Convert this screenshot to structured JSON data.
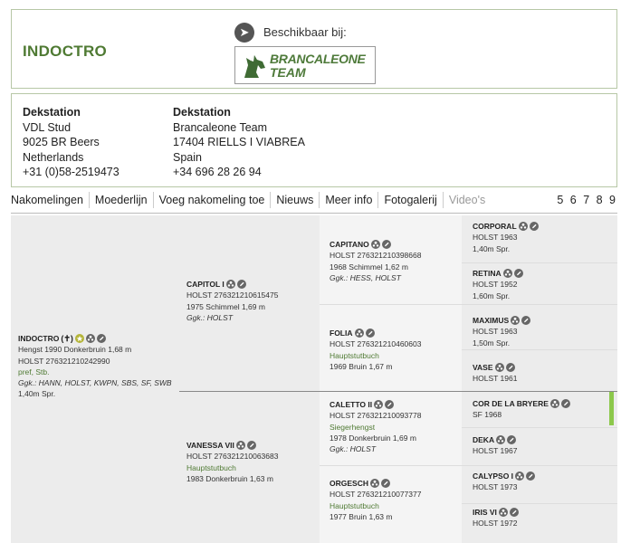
{
  "header": {
    "title": "INDOCTRO",
    "available_label": "Beschikbaar bij:",
    "logo_line1": "BRANCALEONE",
    "logo_line2": "TEAM"
  },
  "stations": [
    {
      "heading": "Dekstation",
      "lines": [
        "VDL Stud",
        "9025 BR Beers",
        "Netherlands",
        "+31 (0)58-2519473"
      ]
    },
    {
      "heading": "Dekstation",
      "lines": [
        "Brancaleone Team",
        "17404 RIELLS I VIABREA",
        "Spain",
        "+34 696 28 26 94"
      ]
    }
  ],
  "nav": {
    "tabs": [
      "Nakomelingen",
      "Moederlijn",
      "Voeg nakomeling toe",
      "Nieuws",
      "Meer info",
      "Fotogalerij",
      "Video's"
    ],
    "pages": "5 6 7 8 9"
  },
  "pedigree": {
    "main": {
      "name": "INDOCTRO",
      "cross": "(✝)",
      "l1": "Hengst 1990 Donkerbruin 1,68 m",
      "l2": "HOLST 276321210242990",
      "l3": "pref, Stb.",
      "l4": "Ggk.: HANN, HOLST, KWPN, SBS, SF, SWB",
      "l5": "1,40m Spr."
    },
    "capitol": {
      "name": "CAPITOL I",
      "l1": "HOLST 276321210615475",
      "l2": "1975 Schimmel 1,69 m",
      "l3": "Ggk.: HOLST"
    },
    "vanessa": {
      "name": "VANESSA VII",
      "l1": "HOLST 276321210063683",
      "l2": "Hauptstutbuch",
      "l3": "1983 Donkerbruin 1,63 m"
    },
    "capitano": {
      "name": "CAPITANO",
      "l1": "HOLST 276321210398668",
      "l2": "1968 Schimmel 1,62 m",
      "l3": "Ggk.: HESS, HOLST"
    },
    "folia": {
      "name": "FOLIA",
      "l1": "HOLST 276321210460603",
      "l2": "Hauptstutbuch",
      "l3": "1969 Bruin 1,67 m"
    },
    "caletto": {
      "name": "CALETTO II",
      "l1": "HOLST 276321210093778",
      "l2": "Siegerhengst",
      "l3": "1978 Donkerbruin 1,69 m",
      "l4": "Ggk.: HOLST"
    },
    "orgesch": {
      "name": "ORGESCH",
      "l1": "HOLST 276321210077377",
      "l2": "Hauptstutbuch",
      "l3": "1977 Bruin 1,63 m"
    },
    "corporal": {
      "name": "CORPORAL",
      "l1": "HOLST 1963",
      "l2": "1,40m Spr."
    },
    "retina": {
      "name": "RETINA",
      "l1": "HOLST 1952",
      "l2": "1,60m Spr."
    },
    "maximus": {
      "name": "MAXIMUS",
      "l1": "HOLST 1963",
      "l2": "1,50m Spr."
    },
    "vase": {
      "name": "VASE",
      "l1": "HOLST 1961"
    },
    "cordelabryere": {
      "name": "COR DE LA BRYERE",
      "l1": "SF 1968"
    },
    "deka": {
      "name": "DEKA",
      "l1": "HOLST 1967"
    },
    "calypso": {
      "name": "CALYPSO I",
      "l1": "HOLST 1973"
    },
    "irisvi": {
      "name": "IRIS VI",
      "l1": "HOLST 1972"
    }
  }
}
